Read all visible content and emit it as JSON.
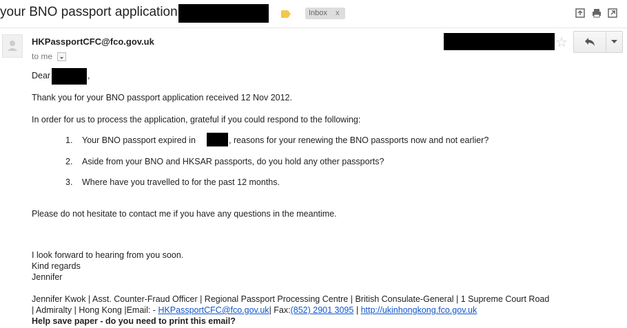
{
  "subject": "your BNO passport application -",
  "labels": {
    "inbox": "Inbox",
    "remove": "x"
  },
  "sender": "HKPassportCFC@fco.gov.uk",
  "to": "to me",
  "greeting": "Dear",
  "greeting_punct": ",",
  "para1": "Thank you for your BNO passport application received 12 Nov 2012.",
  "para2": "In order for us to process the application, grateful if you could respond to the following:",
  "list": [
    {
      "num": "1.",
      "pre": "Your BNO passport expired in",
      "post": ", reasons for your renewing the BNO passports now and not earlier?"
    },
    {
      "num": "2.",
      "pre": "Aside from your BNO and HKSAR passports, do you hold any other passports?"
    },
    {
      "num": "3.",
      "pre": "Where have you travelled to for the past 12 months."
    }
  ],
  "para3": "Please do not hesitate to contact me if you have any questions in the meantime.",
  "closing": [
    "I look forward to hearing from you soon.",
    "Kind regards",
    "Jennifer"
  ],
  "signature": {
    "line1": "Jennifer Kwok | Asst. Counter-Fraud Officer | Regional Passport Processing Centre | British Consulate-General | 1 Supreme Court Road",
    "line2_pre": "| Admiralty | Hong Kong |Email: -",
    "email": "HKPassportCFC@fco.gov.uk",
    "line2_mid": "| Fax:",
    "fax": "(852) 2901 3095",
    "line2_sep": "|",
    "website": "http://ukinhongkong.fco.gov.uk",
    "footer": "Help save paper - do you need to print this email?"
  },
  "icons": [
    "label-icon",
    "archive-icon",
    "print-icon",
    "new-window-icon",
    "star-icon",
    "reply-icon",
    "more-icon"
  ]
}
